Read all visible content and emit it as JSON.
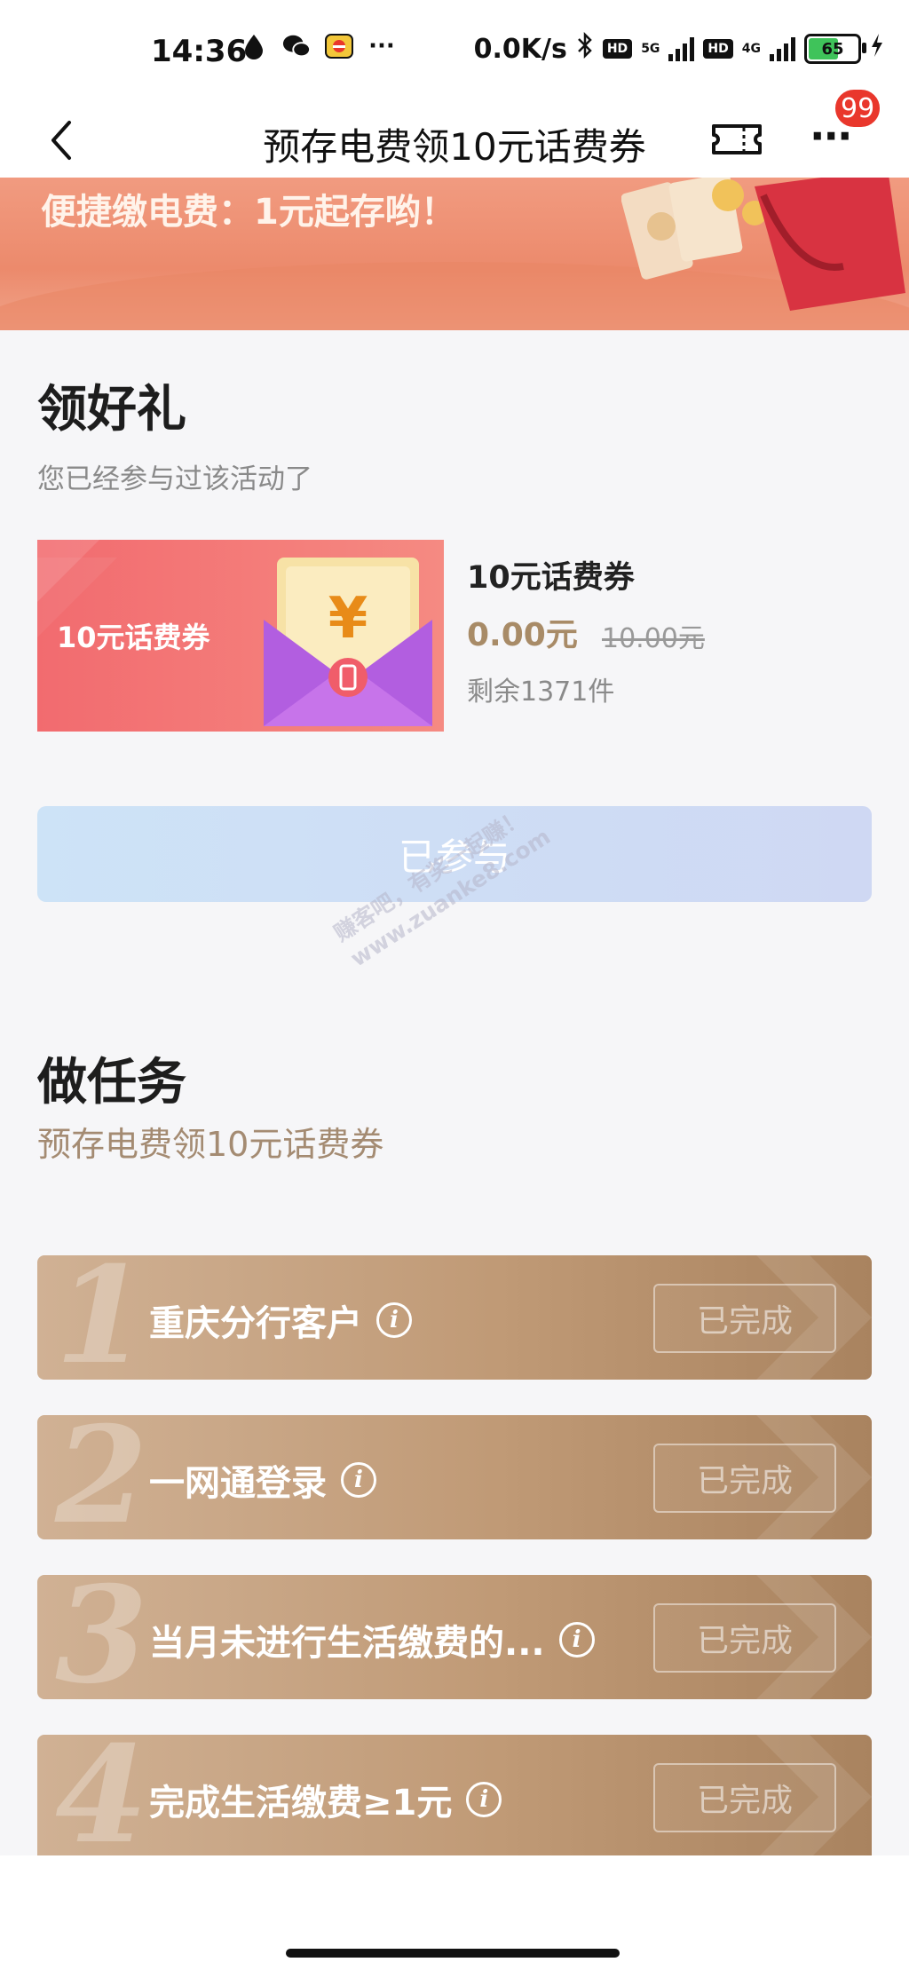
{
  "status_bar": {
    "time": "14:36",
    "speed": "0.0K/s",
    "hd_label": "HD",
    "net1": "5G",
    "net2": "4G",
    "battery": "65",
    "battery_level": 0.65,
    "more_dots": "···"
  },
  "nav": {
    "title": "预存电费领10元话费券",
    "badge": "99",
    "more_glyph": "···"
  },
  "banner": {
    "text": "便捷缴电费：1元起存哟！"
  },
  "gift": {
    "title": "领好礼",
    "subtitle": "您已经参与过该活动了",
    "card_label": "10元话费券",
    "name": "10元话费券",
    "price": "0.00元",
    "original_price": "10.00元",
    "stock": "剩余1371件",
    "button": "已参与"
  },
  "watermark": {
    "line1": "赚客吧，有奖一起赚！",
    "line2": "www.zuanke8.com"
  },
  "tasks": {
    "title": "做任务",
    "subtitle": "预存电费领10元话费券",
    "items": [
      {
        "num": "1",
        "label": "重庆分行客户",
        "status": "已完成"
      },
      {
        "num": "2",
        "label": "一网通登录",
        "status": "已完成"
      },
      {
        "num": "3",
        "label": "当月未进行生活缴费的...",
        "status": "已完成"
      },
      {
        "num": "4",
        "label": "完成生活缴费≥1元",
        "status": "已完成"
      }
    ],
    "info_glyph": "i"
  },
  "icons": {
    "back": "chevron-left-icon",
    "ticket": "ticket-icon",
    "more": "more-icon",
    "info": "info-icon"
  },
  "colors": {
    "accent_gold": "#a88b67",
    "badge_red": "#e9372c",
    "banner": "#ec8a6c",
    "task_bg": "#c09a76"
  }
}
